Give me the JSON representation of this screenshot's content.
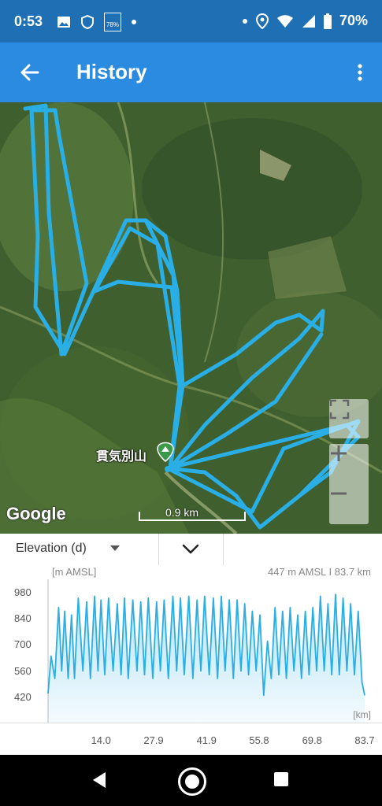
{
  "status_bar": {
    "time": "0:53",
    "battery": "70%",
    "left_icons": [
      "image-icon",
      "shield-icon",
      "activity-badge-icon",
      "dot-icon"
    ],
    "right_icons": [
      "dot-icon",
      "location-icon",
      "wifi-icon",
      "cellular-icon",
      "battery-icon"
    ],
    "badge_text": "78%"
  },
  "app_bar": {
    "title": "History",
    "back_icon": "arrow-left-icon",
    "menu_icon": "more-vert-icon"
  },
  "map": {
    "place_label": "貫気別山",
    "google_logo": "Google",
    "scale_label": "0.9 km",
    "track_color": "#29aee6",
    "buttons": [
      "fullscreen-icon",
      "zoom-in-icon",
      "zoom-out-icon"
    ]
  },
  "chart_toolbar": {
    "selected_metric": "Elevation (d)"
  },
  "chart_data": {
    "type": "area",
    "ylabel": "[m AMSL]",
    "xlabel": "[km]",
    "readout": "447 m AMSL   I   83.7 km",
    "y_ticks": [
      "980",
      "840",
      "700",
      "560",
      "420"
    ],
    "x_ticks": [
      "14.0",
      "27.9",
      "41.9",
      "55.8",
      "69.8",
      "83.7"
    ],
    "ylim": [
      360,
      1000
    ],
    "xlim": [
      0,
      83.7
    ],
    "grid": false,
    "color": "#29aee6",
    "x": [
      0,
      0.8,
      1.8,
      2.8,
      3.6,
      4.4,
      5.3,
      6.2,
      7.0,
      8.0,
      9.2,
      10.2,
      11.2,
      12.3,
      13.2,
      14.0,
      15.0,
      16.0,
      17.2,
      18.3,
      19.3,
      20.2,
      21.2,
      22.4,
      23.5,
      24.5,
      25.5,
      26.5,
      27.7,
      28.7,
      29.7,
      30.7,
      31.8,
      33.0,
      34.0,
      35.0,
      36.0,
      37.2,
      38.3,
      39.4,
      40.4,
      41.4,
      42.6,
      43.7,
      44.8,
      45.8,
      46.8,
      47.9,
      49.0,
      50.0,
      51.0,
      52.0,
      53.0,
      54.0,
      55.0,
      56.0,
      57.0,
      58.0,
      59.0,
      60.0,
      61.0,
      62.0,
      63.0,
      64.0,
      65.0,
      66.0,
      67.0,
      68.0,
      69.0,
      70.0,
      71.0,
      72.0,
      73.0,
      74.0,
      75.0,
      76.0,
      77.0,
      78.0,
      79.0,
      80.0,
      81.0,
      82.0,
      83.0,
      83.7
    ],
    "y": [
      440,
      640,
      520,
      900,
      560,
      880,
      520,
      860,
      520,
      950,
      560,
      930,
      520,
      960,
      560,
      940,
      540,
      950,
      560,
      920,
      540,
      950,
      520,
      940,
      560,
      930,
      540,
      950,
      520,
      930,
      560,
      940,
      520,
      960,
      560,
      950,
      540,
      960,
      520,
      940,
      560,
      960,
      540,
      950,
      520,
      960,
      560,
      940,
      520,
      940,
      560,
      920,
      540,
      880,
      560,
      860,
      430,
      720,
      520,
      900,
      540,
      880,
      520,
      900,
      560,
      860,
      520,
      880,
      540,
      900,
      560,
      960,
      560,
      920,
      540,
      970,
      540,
      950,
      560,
      920,
      540,
      880,
      500,
      430
    ]
  },
  "nav_bar": {
    "buttons": [
      "back-triangle-icon",
      "home-circle-icon",
      "recents-square-icon"
    ]
  }
}
